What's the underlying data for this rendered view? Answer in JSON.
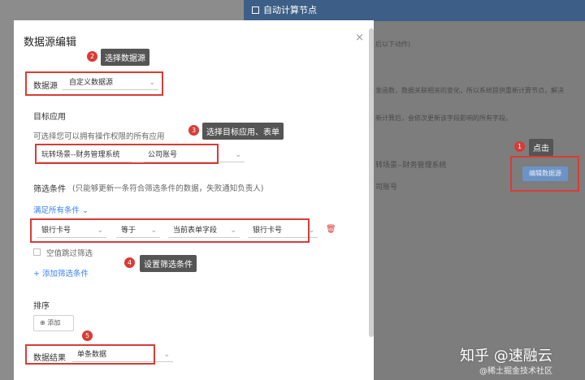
{
  "background": {
    "header_title": "自动计算节点",
    "texts": [
      "后以下动作)",
      "发函数，数据关联相关的变化，所以系统提供重新计算节点，解决",
      "新计算后，会依次更新该字段影响的所有字段。",
      "转场景--财务管理系统",
      "司账号"
    ],
    "edit_button": "编辑数据源"
  },
  "dialog": {
    "title": "数据源编辑",
    "close": "×",
    "datasource_label": "数据源",
    "datasource_value": "自定义数据源",
    "target_app_label": "目标应用",
    "target_app_hint": "可选择您可以拥有操作权限的所有应用",
    "target_app_value": "玩转场景--财务管理系统",
    "target_form_value": "公司账号",
    "filter_label": "筛选条件",
    "filter_hint": "(只能够更新一条符合筛选条件的数据，失败通知负责人)",
    "match_all": "满足所有条件",
    "filter_row": {
      "field": "银行卡号",
      "op": "等于",
      "source": "当前表单字段",
      "value": "银行卡号"
    },
    "skip_empty": "空值跳过筛选",
    "add_filter": "添加筛选条件",
    "sort_label": "排序",
    "add_sort": "添加",
    "result_label": "数据结果",
    "result_value": "单条数据"
  },
  "annotations": [
    {
      "num": "1",
      "text": "点击"
    },
    {
      "num": "2",
      "text": "选择数据源"
    },
    {
      "num": "3",
      "text": "选择目标应用、表单"
    },
    {
      "num": "4",
      "text": "设置筛选条件"
    },
    {
      "num": "5",
      "text": ""
    }
  ],
  "watermark": "知乎 @速融云",
  "watermark_sub": "@稀土掘金技术社区"
}
